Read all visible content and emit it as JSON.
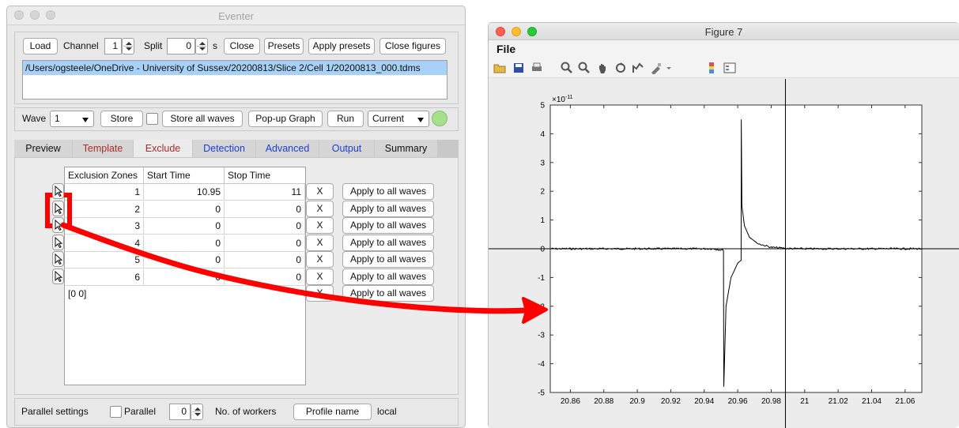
{
  "eventer": {
    "title": "Eventer",
    "load": "Load",
    "channel_label": "Channel",
    "channel_value": "1",
    "split_label": "Split",
    "split_value": "0",
    "split_unit": "s",
    "close": "Close",
    "presets": "Presets",
    "apply_presets": "Apply presets",
    "close_figures": "Close figures",
    "file_path": "/Users/ogsteele/OneDrive - University of Sussex/20200813/Slice 2/Cell 1/20200813_000.tdms",
    "wave_label": "Wave",
    "wave_value": "1",
    "store": "Store",
    "store_all": "Store all waves",
    "popup_graph": "Pop-up Graph",
    "run": "Run",
    "current": "Current",
    "tabs": [
      {
        "label": "Preview",
        "color": "#111111"
      },
      {
        "label": "Template",
        "color": "#b02a2a"
      },
      {
        "label": "Exclude",
        "color": "#b02a2a"
      },
      {
        "label": "Detection",
        "color": "#1a3fd6"
      },
      {
        "label": "Advanced",
        "color": "#1a3fd6"
      },
      {
        "label": "Output",
        "color": "#1a3fd6"
      },
      {
        "label": "Summary",
        "color": "#111111"
      }
    ],
    "table": {
      "headers": [
        "Exclusion Zones",
        "Start Time",
        "Stop Time"
      ],
      "rows": [
        {
          "zone": "1",
          "start": "10.95",
          "stop": "11"
        },
        {
          "zone": "2",
          "start": "0",
          "stop": "0"
        },
        {
          "zone": "3",
          "start": "0",
          "stop": "0"
        },
        {
          "zone": "4",
          "start": "0",
          "stop": "0"
        },
        {
          "zone": "5",
          "start": "0",
          "stop": "0"
        },
        {
          "zone": "6",
          "start": "0",
          "stop": "0"
        }
      ],
      "summary": "[0 0]"
    },
    "x_label": "X",
    "apply_all": "Apply to all waves",
    "parallel_settings": "Parallel settings",
    "parallel": "Parallel",
    "workers_value": "0",
    "workers_label": "No. of workers",
    "profile_name": "Profile name",
    "profile_value": "local"
  },
  "figure": {
    "title": "Figure 7",
    "menu_file": "File",
    "toolbar_icons": [
      "open-icon",
      "save-icon",
      "print-icon",
      "zoom-in-icon",
      "zoom-out-icon",
      "pan-icon",
      "rotate-icon",
      "data-cursor-icon",
      "brush-icon",
      "colorbar-icon",
      "legend-icon"
    ],
    "exponent_label": "×10",
    "exponent_power": "-11"
  },
  "chart_data": {
    "type": "line",
    "title": "",
    "xlabel": "",
    "ylabel": "",
    "xlim": [
      20.848,
      21.07
    ],
    "ylim": [
      -5,
      5
    ],
    "y_multiplier": "1e-11",
    "x_ticks": [
      "20.86",
      "20.88",
      "20.9",
      "20.92",
      "20.94",
      "20.96",
      "20.98",
      "21",
      "21.02",
      "21.04",
      "21.06"
    ],
    "x_tick_values": [
      20.86,
      20.88,
      20.9,
      20.92,
      20.94,
      20.96,
      20.98,
      21.0,
      21.02,
      21.04,
      21.06
    ],
    "y_ticks": [
      -5,
      -4,
      -3,
      -2,
      -1,
      0,
      1,
      2,
      3,
      4,
      5
    ],
    "crosshair": {
      "x": 20.9885,
      "y": 0
    },
    "series": [
      {
        "color": "#000000",
        "x": [
          20.848,
          20.9,
          20.945,
          20.9515,
          20.9517,
          20.953,
          20.956,
          20.96,
          20.962,
          20.9621,
          20.9625,
          20.964,
          20.967,
          20.972,
          20.98,
          20.99,
          21.0,
          21.07
        ],
        "y": [
          0,
          0,
          0,
          -0.05,
          -4.8,
          -2.0,
          -1.0,
          -0.5,
          -0.4,
          4.5,
          1.5,
          0.8,
          0.4,
          0.18,
          0.05,
          0.01,
          0,
          0
        ]
      }
    ]
  },
  "colors": {
    "highlight": "#ff0000",
    "selection": "#a7d1f6",
    "status_light": "#a6e08c"
  }
}
